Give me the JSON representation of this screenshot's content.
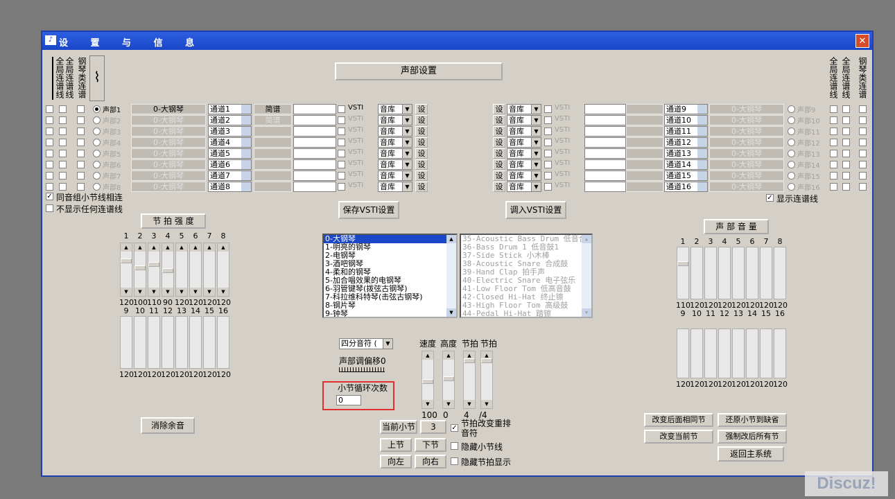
{
  "window": {
    "title": "设 置 与 信 息",
    "close": "✕"
  },
  "left_vlabels": [
    "全局连谱线",
    "全局连谱线",
    "钢琴类连谱"
  ],
  "right_vlabels": [
    "全局连谱线",
    "全局连谱线",
    "钢琴类连谱"
  ],
  "header_button": "声部设置",
  "left_voices": [
    {
      "voice": "声部1",
      "instrument": "0-大钢琴",
      "channel": "通道1",
      "notation": "简谱",
      "vsti": "VSTI",
      "lib": "音库",
      "set": "设"
    },
    {
      "voice": "声部2",
      "instrument": "0-大钢琴",
      "channel": "通道2",
      "notation": "简谱",
      "vsti": "VSTI",
      "lib": "音库",
      "set": "设"
    },
    {
      "voice": "声部3",
      "instrument": "0-大钢琴",
      "channel": "通道3",
      "notation": "",
      "vsti": "VSTI",
      "lib": "音库",
      "set": "设"
    },
    {
      "voice": "声部4",
      "instrument": "0-大钢琴",
      "channel": "通道4",
      "notation": "",
      "vsti": "VSTI",
      "lib": "音库",
      "set": "设"
    },
    {
      "voice": "声部5",
      "instrument": "0-大钢琴",
      "channel": "通道5",
      "notation": "",
      "vsti": "VSTI",
      "lib": "音库",
      "set": "设"
    },
    {
      "voice": "声部6",
      "instrument": "0-大钢琴",
      "channel": "通道6",
      "notation": "",
      "vsti": "VSTI",
      "lib": "音库",
      "set": "设"
    },
    {
      "voice": "声部7",
      "instrument": "0-大钢琴",
      "channel": "通道7",
      "notation": "",
      "vsti": "VSTI",
      "lib": "音库",
      "set": "设"
    },
    {
      "voice": "声部8",
      "instrument": "0-大钢琴",
      "channel": "通道8",
      "notation": "",
      "vsti": "VSTI",
      "lib": "音库",
      "set": "设"
    }
  ],
  "right_voices": [
    {
      "voice": "声部9",
      "instrument": "0-大钢琴",
      "channel": "通道9",
      "vsti": "VSTI",
      "lib": "音库",
      "set": "设"
    },
    {
      "voice": "声部10",
      "instrument": "0-大钢琴",
      "channel": "通道10",
      "vsti": "VSTI",
      "lib": "音库",
      "set": "设"
    },
    {
      "voice": "声部11",
      "instrument": "0-大钢琴",
      "channel": "通道11",
      "vsti": "VSTI",
      "lib": "音库",
      "set": "设"
    },
    {
      "voice": "声部12",
      "instrument": "0-大钢琴",
      "channel": "通道12",
      "vsti": "VSTI",
      "lib": "音库",
      "set": "设"
    },
    {
      "voice": "声部13",
      "instrument": "0-大钢琴",
      "channel": "通道13",
      "vsti": "VSTI",
      "lib": "音库",
      "set": "设"
    },
    {
      "voice": "声部14",
      "instrument": "0-大钢琴",
      "channel": "通道14",
      "vsti": "VSTI",
      "lib": "音库",
      "set": "设"
    },
    {
      "voice": "声部15",
      "instrument": "0-大钢琴",
      "channel": "通道15",
      "vsti": "VSTI",
      "lib": "音库",
      "set": "设"
    },
    {
      "voice": "声部16",
      "instrument": "0-大钢琴",
      "channel": "通道16",
      "vsti": "VSTI",
      "lib": "音库",
      "set": "设"
    }
  ],
  "options": {
    "same_group_link": "同音组小节线相连",
    "no_link": "不显示任何连谱线",
    "show_link": "显示连谱线",
    "save_vsti": "保存VSTI设置",
    "load_vsti": "调入VSTI设置"
  },
  "beat_strength": {
    "title": "节 拍 强 度",
    "top_labels": [
      "1",
      "2",
      "3",
      "4",
      "5",
      "6",
      "7",
      "8"
    ],
    "top_values": [
      "120",
      "100",
      "110",
      "90",
      "120",
      "120",
      "120",
      "120"
    ],
    "bottom_labels": [
      "9",
      "10",
      "11",
      "12",
      "13",
      "14",
      "15",
      "16"
    ],
    "bottom_values": [
      "120",
      "120",
      "120",
      "120",
      "120",
      "120",
      "120",
      "120"
    ]
  },
  "voice_volume": {
    "title": "声 部 音 量",
    "top_labels": [
      "1",
      "2",
      "3",
      "4",
      "5",
      "6",
      "7",
      "8"
    ],
    "top_values": [
      "110",
      "120",
      "120",
      "120",
      "120",
      "120",
      "120",
      "120"
    ],
    "bottom_labels": [
      "9",
      "10",
      "11",
      "12",
      "13",
      "14",
      "15",
      "16"
    ],
    "bottom_values": [
      "120",
      "120",
      "120",
      "120",
      "120",
      "120",
      "120",
      "120"
    ]
  },
  "instrument_list": [
    "0-大钢琴",
    "1-明亮的钢琴",
    "2-电钢琴",
    "3-酒吧钢琴",
    "4-柔和的钢琴",
    "5-加合唱效果的电钢琴",
    "6-羽管键琴(拨弦古钢琴)",
    "7-科拉维科特琴(击弦古钢琴)",
    "8-钢片琴",
    "9-钟琴"
  ],
  "drum_list": [
    "35-Acoustic Bass Drum  低音合",
    "36-Bass Drum 1 低音鼓1",
    "37-Side Stick 小木棒",
    "38-Acoustic Snare 合成鼓",
    "39-Hand Clap 拍手声",
    "40-Electric Snare 电子弦乐",
    "41-Low Floor Tom 低高音鼓",
    "42-Closed Hi-Hat 终止镲",
    "43-High Floor Tom 高级鼓",
    "44-Pedal Hi-Hat 踏镲"
  ],
  "note_unit": "四分音符 (",
  "voice_shift": "声部调偏移0",
  "loop_label": "小节循环次数",
  "loop_value": "0",
  "speed": {
    "label": "速度",
    "value": "100"
  },
  "height": {
    "label": "高度",
    "value": "0"
  },
  "beat1": {
    "label": "节拍",
    "value": "4"
  },
  "beat2": {
    "label": "节拍",
    "value": "/4"
  },
  "current_bar": {
    "label": "当前小节",
    "value": "3"
  },
  "nav": {
    "prev": "上节",
    "next": "下节",
    "left": "向左",
    "right": "向右"
  },
  "checks": {
    "rearrange": "节拍改变重排音符",
    "hide_bar": "隐藏小节线",
    "hide_beat": "隐藏节拍显示"
  },
  "actions": {
    "clear_rest": "消除余音",
    "change_after": "改变后面相同节",
    "restore_default": "还原小节到缺省",
    "change_current": "改变当前节",
    "force_after": "强制改后所有节",
    "return_main": "返回主系统"
  },
  "watermark": "Discuz!"
}
